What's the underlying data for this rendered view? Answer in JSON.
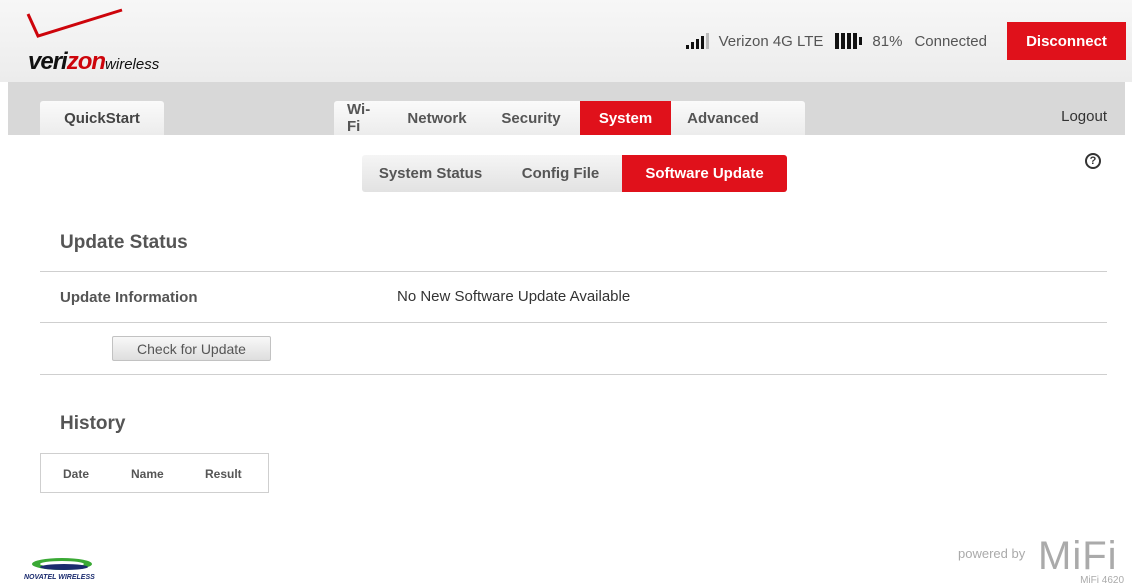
{
  "header": {
    "logo_brand_pre": "veri",
    "logo_brand_red": "zon",
    "logo_brand_post": "wireless",
    "signal_bars": 4,
    "signal_total": 5,
    "carrier": "Verizon 4G LTE",
    "battery_percent": "81%",
    "connection_status": "Connected",
    "disconnect_label": "Disconnect",
    "accent_color": "#e0111b"
  },
  "nav": {
    "quickstart_label": "QuickStart",
    "tabs": [
      {
        "label": "Wi-Fi",
        "active": false
      },
      {
        "label": "Network",
        "active": false
      },
      {
        "label": "Security",
        "active": false
      },
      {
        "label": "System",
        "active": true
      },
      {
        "label": "Advanced",
        "active": false
      }
    ],
    "logout_label": "Logout"
  },
  "subnav": {
    "tabs": [
      {
        "label": "System Status",
        "active": false
      },
      {
        "label": "Config File",
        "active": false
      },
      {
        "label": "Software Update",
        "active": true
      }
    ],
    "help_icon": "help-icon"
  },
  "update_status": {
    "title": "Update Status",
    "info_label": "Update Information",
    "info_value": "No New Software Update Available",
    "check_button_label": "Check for Update"
  },
  "history": {
    "title": "History",
    "columns": [
      "Date",
      "Name",
      "Result"
    ]
  },
  "footer": {
    "novatel_text": "NOVATEL WIRELESS",
    "powered_by": "powered by",
    "mifi": "MiFi",
    "model": "MiFi 4620"
  }
}
